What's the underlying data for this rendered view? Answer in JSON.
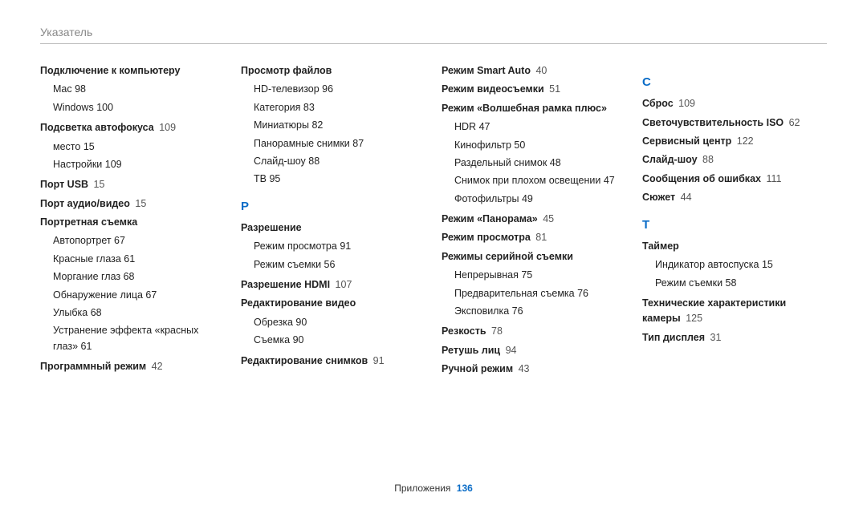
{
  "header": {
    "title": "Указатель"
  },
  "footer": {
    "label": "Приложения",
    "page": "136"
  },
  "colors": {
    "accent": "#0a6cc7"
  },
  "columns": [
    {
      "items": [
        {
          "type": "entry",
          "bold": true,
          "label": "Подключение к компьютеру",
          "page": ""
        },
        {
          "type": "sublist",
          "items": [
            {
              "label": "Mac",
              "page": "98"
            },
            {
              "label": "Windows",
              "page": "100"
            }
          ]
        },
        {
          "type": "entry",
          "bold": true,
          "label": "Подсветка автофокуса",
          "page": "109"
        },
        {
          "type": "sublist",
          "items": [
            {
              "label": "место",
              "page": "15"
            },
            {
              "label": "Настройки",
              "page": "109"
            }
          ]
        },
        {
          "type": "entry",
          "bold": true,
          "label": "Порт USB",
          "page": "15"
        },
        {
          "type": "entry",
          "bold": true,
          "label": "Порт аудио/видео",
          "page": "15"
        },
        {
          "type": "entry",
          "bold": true,
          "label": "Портретная съемка",
          "page": ""
        },
        {
          "type": "sublist",
          "items": [
            {
              "label": "Автопортрет",
              "page": "67"
            },
            {
              "label": "Красные глаза",
              "page": "61"
            },
            {
              "label": "Моргание глаз",
              "page": "68"
            },
            {
              "label": "Обнаружение лица",
              "page": "67"
            },
            {
              "label": "Улыбка",
              "page": "68"
            },
            {
              "label": "Устранение эффекта «красных глаз»",
              "page": "61"
            }
          ]
        },
        {
          "type": "entry",
          "bold": true,
          "label": "Программный режим",
          "page": "42"
        }
      ]
    },
    {
      "items": [
        {
          "type": "entry",
          "bold": true,
          "label": "Просмотр файлов",
          "page": ""
        },
        {
          "type": "sublist",
          "items": [
            {
              "label": "HD-телевизор",
              "page": "96"
            },
            {
              "label": "Категория",
              "page": "83"
            },
            {
              "label": "Миниатюры",
              "page": "82"
            },
            {
              "label": "Панорамные снимки",
              "page": "87"
            },
            {
              "label": "Слайд-шоу",
              "page": "88"
            },
            {
              "label": "ТВ",
              "page": "95"
            }
          ]
        },
        {
          "type": "letter",
          "label": "Р"
        },
        {
          "type": "entry",
          "bold": true,
          "label": "Разрешение",
          "page": ""
        },
        {
          "type": "sublist",
          "items": [
            {
              "label": "Режим просмотра",
              "page": "91"
            },
            {
              "label": "Режим съемки",
              "page": "56"
            }
          ]
        },
        {
          "type": "entry",
          "bold": true,
          "label": "Разрешение HDMI",
          "page": "107"
        },
        {
          "type": "entry",
          "bold": true,
          "label": "Редактирование видео",
          "page": ""
        },
        {
          "type": "sublist",
          "items": [
            {
              "label": "Обрезка",
              "page": "90"
            },
            {
              "label": "Съемка",
              "page": "90"
            }
          ]
        },
        {
          "type": "entry",
          "bold": true,
          "label": "Редактирование снимков",
          "page": "91"
        }
      ]
    },
    {
      "items": [
        {
          "type": "entry",
          "bold": true,
          "label": "Режим Smart Auto",
          "page": "40"
        },
        {
          "type": "entry",
          "bold": true,
          "label": "Режим видеосъемки",
          "page": "51"
        },
        {
          "type": "entry",
          "bold": true,
          "label": "Режим «Волшебная рамка плюс»",
          "page": ""
        },
        {
          "type": "sublist",
          "items": [
            {
              "label": "HDR",
              "page": "47"
            },
            {
              "label": "Кинофильтр",
              "page": "50"
            },
            {
              "label": "Раздельный снимок",
              "page": "48"
            },
            {
              "label": "Снимок при плохом освещении",
              "page": "47"
            },
            {
              "label": "Фотофильтры",
              "page": "49"
            }
          ]
        },
        {
          "type": "entry",
          "bold": true,
          "label": "Режим «Панорама»",
          "page": "45"
        },
        {
          "type": "entry",
          "bold": true,
          "label": "Режим просмотра",
          "page": "81"
        },
        {
          "type": "entry",
          "bold": true,
          "label": "Режимы серийной съемки",
          "page": ""
        },
        {
          "type": "sublist",
          "items": [
            {
              "label": "Непрерывная",
              "page": "75"
            },
            {
              "label": "Предварительная съемка",
              "page": "76"
            },
            {
              "label": "Эксповилка",
              "page": "76"
            }
          ]
        },
        {
          "type": "entry",
          "bold": true,
          "label": "Резкость",
          "page": "78"
        },
        {
          "type": "entry",
          "bold": true,
          "label": "Ретушь лиц",
          "page": "94"
        },
        {
          "type": "entry",
          "bold": true,
          "label": "Ручной режим",
          "page": "43"
        }
      ]
    },
    {
      "items": [
        {
          "type": "letter",
          "label": "С"
        },
        {
          "type": "entry",
          "bold": true,
          "label": "Сброс",
          "page": "109"
        },
        {
          "type": "entry",
          "bold": true,
          "label": "Светочувствительность ISO",
          "page": "62"
        },
        {
          "type": "entry",
          "bold": true,
          "label": "Сервисный центр",
          "page": "122"
        },
        {
          "type": "entry",
          "bold": true,
          "label": "Слайд-шоу",
          "page": "88"
        },
        {
          "type": "entry",
          "bold": true,
          "label": "Сообщения об ошибках",
          "page": "111"
        },
        {
          "type": "entry",
          "bold": true,
          "label": "Сюжет",
          "page": "44"
        },
        {
          "type": "letter",
          "label": "Т"
        },
        {
          "type": "entry",
          "bold": true,
          "label": "Таймер",
          "page": ""
        },
        {
          "type": "sublist",
          "items": [
            {
              "label": "Индикатор автоспуска",
              "page": "15"
            },
            {
              "label": "Режим съемки",
              "page": "58"
            }
          ]
        },
        {
          "type": "entry",
          "bold": true,
          "label": "Технические характеристики камеры",
          "page": "125"
        },
        {
          "type": "entry",
          "bold": true,
          "label": "Тип дисплея",
          "page": "31"
        }
      ]
    }
  ]
}
